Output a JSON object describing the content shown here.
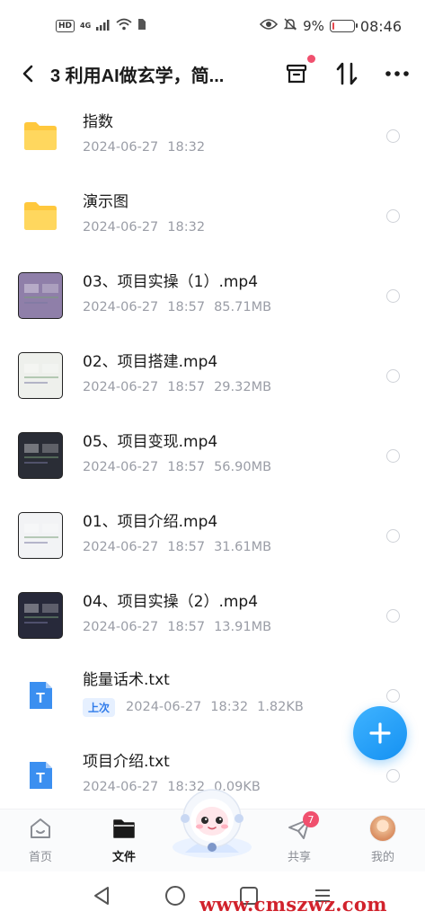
{
  "status_bar": {
    "hd": "HD",
    "network": "4G",
    "battery_percent": "9%",
    "battery_level": 0.09,
    "time": "08:46"
  },
  "header": {
    "title": "3 利用AI做玄学，简...",
    "back_icon": "chevron-left-icon",
    "actions": [
      "archive-icon",
      "sort-icon",
      "more-icon"
    ]
  },
  "files": [
    {
      "name": "指数",
      "kind": "folder",
      "date": "2024-06-27",
      "time": "18:32",
      "size": ""
    },
    {
      "name": "演示图",
      "kind": "folder",
      "date": "2024-06-27",
      "time": "18:32",
      "size": ""
    },
    {
      "name": "03、项目实操（1）.mp4",
      "kind": "video",
      "date": "2024-06-27",
      "time": "18:57",
      "size": "85.71MB"
    },
    {
      "name": "02、项目搭建.mp4",
      "kind": "video",
      "date": "2024-06-27",
      "time": "18:57",
      "size": "29.32MB"
    },
    {
      "name": "05、项目变现.mp4",
      "kind": "video",
      "date": "2024-06-27",
      "time": "18:57",
      "size": "56.90MB"
    },
    {
      "name": "01、项目介绍.mp4",
      "kind": "video",
      "date": "2024-06-27",
      "time": "18:57",
      "size": "31.61MB"
    },
    {
      "name": "04、项目实操（2）.mp4",
      "kind": "video",
      "date": "2024-06-27",
      "time": "18:57",
      "size": "13.91MB"
    },
    {
      "name": "能量话术.txt",
      "kind": "txt",
      "tag": "上次",
      "date": "2024-06-27",
      "time": "18:32",
      "size": "1.82KB"
    },
    {
      "name": "项目介绍.txt",
      "kind": "txt",
      "date": "2024-06-27",
      "time": "18:32",
      "size": "0.09KB"
    }
  ],
  "fab": {
    "icon": "plus-icon"
  },
  "tabs": [
    {
      "label": "首页",
      "icon": "home-icon",
      "active": false
    },
    {
      "label": "文件",
      "icon": "folder-icon",
      "active": true
    },
    {
      "label": "共享",
      "icon": "share-icon",
      "active": false,
      "badge": "7"
    },
    {
      "label": "我的",
      "icon": "avatar-icon",
      "active": false
    }
  ],
  "nav": [
    "back-triangle-icon",
    "home-circle-icon",
    "recents-square-icon",
    "menu-lines-icon"
  ],
  "watermark": "www.cmszwz.com",
  "colors": {
    "accent": "#1591f2",
    "badge": "#f0506e",
    "folder": "#ffc83d",
    "txt_icon": "#3b8ff0"
  }
}
